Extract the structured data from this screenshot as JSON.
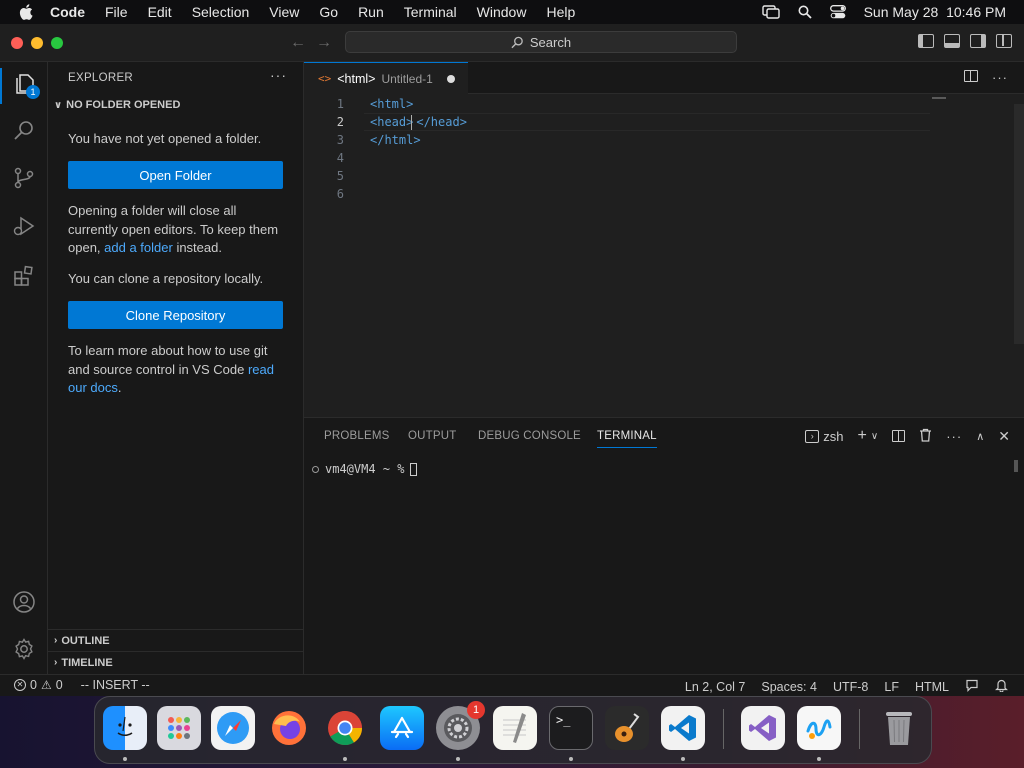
{
  "menubar": {
    "app_name": "Code",
    "items": [
      "File",
      "Edit",
      "Selection",
      "View",
      "Go",
      "Run",
      "Terminal",
      "Window",
      "Help"
    ],
    "datetime": "Sun May 28  10:46 PM"
  },
  "titlebar": {
    "search_label": "Search"
  },
  "activity_bar": {
    "explorer_badge": "1"
  },
  "sidebar": {
    "title": "EXPLORER",
    "more": "···",
    "section": "NO FOLDER OPENED",
    "text_no_folder": "You have not yet opened a folder.",
    "open_folder_button": "Open Folder",
    "text_opening_1": "Opening a folder will close all currently open editors. To keep them open, ",
    "text_opening_link": "add a folder",
    "text_opening_2": " instead.",
    "text_clone": "You can clone a repository locally.",
    "clone_button": "Clone Repository",
    "text_learn": "To learn more about how to use git and source control in VS Code ",
    "text_learn_link": "read our docs",
    "text_learn_end": ".",
    "outline": "OUTLINE",
    "timeline": "TIMELINE"
  },
  "editor": {
    "tab_icon": "<>",
    "tab_name": "<html>",
    "tab_desc": "Untitled-1",
    "line_numbers": [
      "1",
      "2",
      "3",
      "4",
      "5",
      "6"
    ],
    "lines": [
      {
        "t1": "<html>",
        "t2": ""
      },
      {
        "t1": "<head>",
        "t2": "</head>"
      },
      {
        "t1": "</html>",
        "t2": ""
      }
    ]
  },
  "panel": {
    "tabs": [
      "PROBLEMS",
      "OUTPUT",
      "DEBUG CONSOLE",
      "TERMINAL"
    ],
    "shell": "zsh",
    "prompt": "vm4@VM4 ~ %"
  },
  "statusbar": {
    "errors": "0",
    "warnings": "0",
    "mode": "-- INSERT --",
    "position": "Ln 2, Col 7",
    "spaces": "Spaces: 4",
    "encoding": "UTF-8",
    "eol": "LF",
    "language": "HTML"
  },
  "dock": {
    "settings_badge": "1"
  },
  "colors": {
    "accent": "#0078d4",
    "link": "#4daafc",
    "tag": "#569cd6"
  }
}
